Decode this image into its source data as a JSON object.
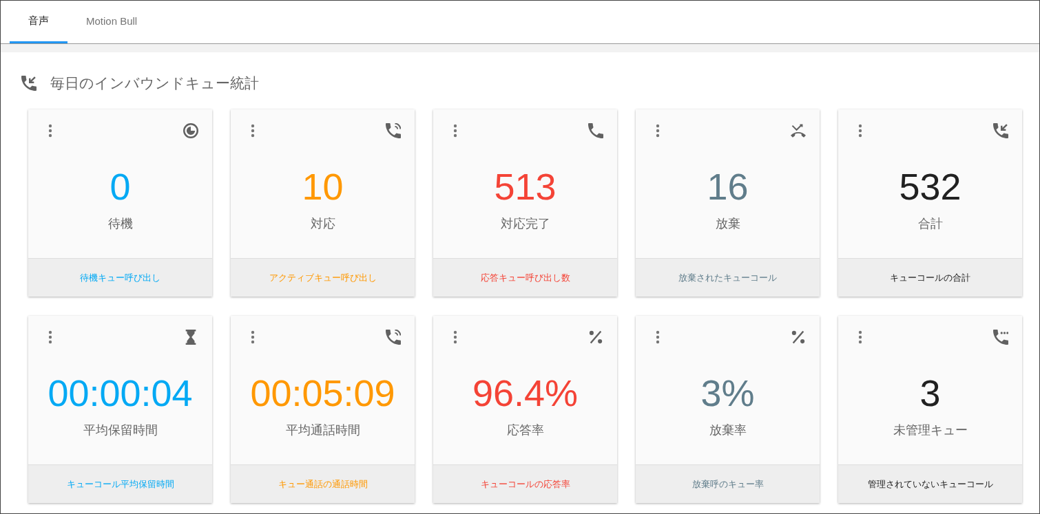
{
  "tabs": [
    {
      "label": "音声",
      "selected": true
    },
    {
      "label": "Motion Bull",
      "selected": false
    }
  ],
  "section": {
    "title": "毎日のインバウンドキュー統計"
  },
  "cards": [
    {
      "kind": "clock",
      "value": "0",
      "label": "待機",
      "footer": "待機キュー呼び出し",
      "color": "#03a9f4"
    },
    {
      "kind": "phone-ring",
      "value": "10",
      "label": "対応",
      "footer": "アクティブキュー呼び出し",
      "color": "#ff9800"
    },
    {
      "kind": "phone",
      "value": "513",
      "label": "対応完了",
      "footer": "応答キュー呼び出し数",
      "color": "#f44336"
    },
    {
      "kind": "phone-missed",
      "value": "16",
      "label": "放棄",
      "footer": "放棄されたキューコール",
      "color": "#607d8b"
    },
    {
      "kind": "phone-incoming",
      "value": "532",
      "label": "合計",
      "footer": "キューコールの合計",
      "color": "#212121"
    },
    {
      "kind": "hourglass",
      "value": "00:00:04",
      "label": "平均保留時間",
      "footer": "キューコール平均保留時間",
      "color": "#03a9f4"
    },
    {
      "kind": "phone-ring",
      "value": "00:05:09",
      "label": "平均通話時間",
      "footer": "キュー通話の通話時間",
      "color": "#ff9800"
    },
    {
      "kind": "percent",
      "value": "96.4%",
      "label": "応答率",
      "footer": "キューコールの応答率",
      "color": "#f44336"
    },
    {
      "kind": "percent",
      "value": "3%",
      "label": "放棄率",
      "footer": "放棄呼のキュー率",
      "color": "#607d8b"
    },
    {
      "kind": "phone-paused",
      "value": "3",
      "label": "未管理キュー",
      "footer": "管理されていないキューコール",
      "color": "#212121"
    }
  ]
}
